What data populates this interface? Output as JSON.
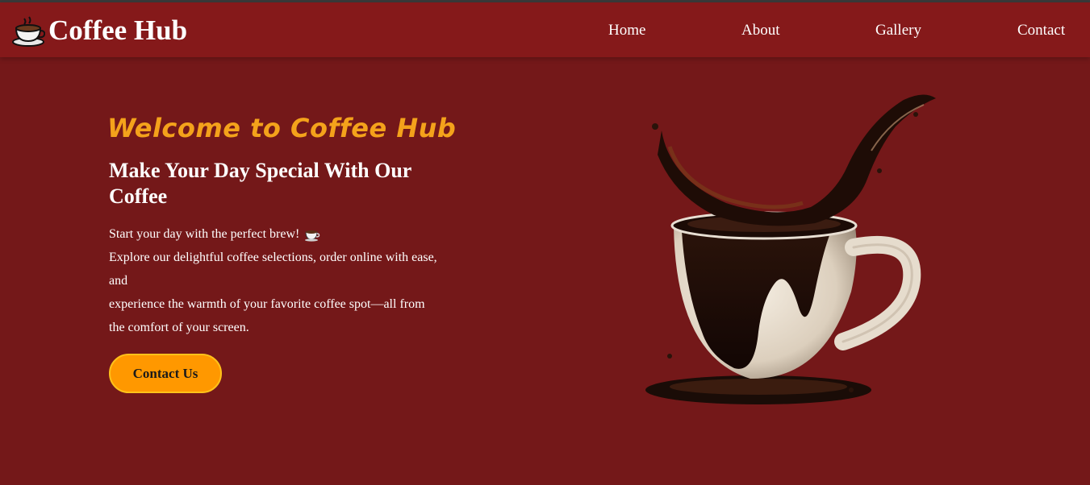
{
  "navbar": {
    "brand": "Coffee Hub",
    "brand_icon": "coffee-cup-icon",
    "links": [
      "Home",
      "About",
      "Gallery",
      "Contact"
    ]
  },
  "hero": {
    "welcome": "Welcome to Coffee Hub",
    "headline": "Make Your Day Special With Our Coffee",
    "desc_lines": [
      "Start your day with the perfect brew!",
      "Explore our delightful coffee selections, order online with ease, and",
      "experience the warmth of your favorite coffee spot—all from the comfort of your screen."
    ],
    "button": "Contact Us",
    "image_alt_icon": "coffee-splash-image"
  },
  "colors": {
    "background": "#741819",
    "navbar": "#85191a",
    "accent": "#f4a21b",
    "button": "#ff9800"
  }
}
